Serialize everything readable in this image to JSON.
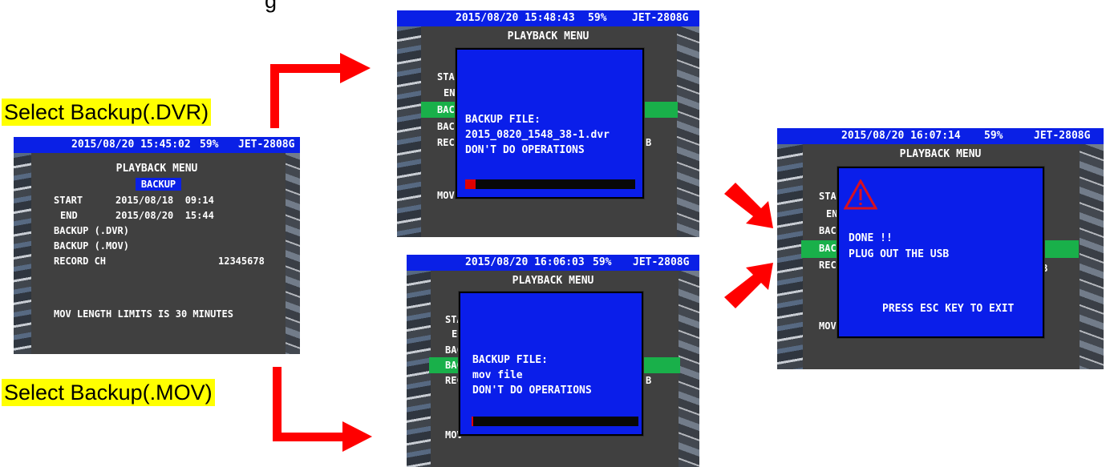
{
  "partial_top_text": "g",
  "captions": {
    "dvr": "Select Backup(.DVR)",
    "mov": "Select Backup(.MOV)"
  },
  "screen_main": {
    "status": {
      "datetime": "2015/08/20 15:45:02",
      "battery": "59%",
      "model": "JET-2808G"
    },
    "title": "PLAYBACK MENU",
    "badge": "BACKUP",
    "start_label": "START",
    "start_value": "2015/08/18  09:14",
    "end_label": "END",
    "end_value": "2015/08/20  15:44",
    "backup_dvr": "BACKUP (.DVR)",
    "backup_mov": "BACKUP (.MOV)",
    "record_ch_label": "RECORD CH",
    "record_ch_value": "12345678",
    "note": "MOV LENGTH LIMITS IS 30 MINUTES"
  },
  "screen_dvr": {
    "status": {
      "datetime": "2015/08/20 15:48:43",
      "battery": "59%",
      "model": "JET-2808G"
    },
    "title": "PLAYBACK MENU",
    "side_labels": [
      "STA",
      "EN",
      "BAC",
      "BAC",
      "REC",
      "MOV"
    ],
    "edge_letter": "B",
    "line1": "BACKUP FILE:",
    "line2": "2015_0820_1548_38-1.dvr",
    "line3": "DON'T DO OPERATIONS",
    "progress": 0.06,
    "accent": "#e00000"
  },
  "screen_mov": {
    "status": {
      "datetime": "2015/08/20 16:06:03",
      "battery": "59%",
      "model": "JET-2808G"
    },
    "title": "PLAYBACK MENU",
    "side_labels": [
      "STA",
      "EN",
      "BAC",
      "BAC",
      "REC",
      "MOV"
    ],
    "edge_letter": "B",
    "line1": "BACKUP FILE:",
    "line2": "mov file",
    "line3": "DON'T DO OPERATIONS",
    "progress": 0.01
  },
  "screen_done": {
    "status": {
      "datetime": "2015/08/20 16:07:14",
      "battery": "59%",
      "model": "JET-2808G"
    },
    "title": "PLAYBACK MENU",
    "side_labels": [
      "STA",
      "EN",
      "BAC",
      "BAC",
      "REC",
      "MOV"
    ],
    "edge_letter": "B",
    "line1": "DONE !!",
    "line2": "PLUG OUT THE USB",
    "line3": "PRESS ESC KEY TO EXIT",
    "icon": "warning-triangle-icon"
  },
  "colors": {
    "arrow": "#ff0000",
    "dialog_blue": "#0a1eea",
    "status_blue": "#0a20e6",
    "highlight_green": "#19b04a",
    "caption_bg": "#ffff00"
  }
}
